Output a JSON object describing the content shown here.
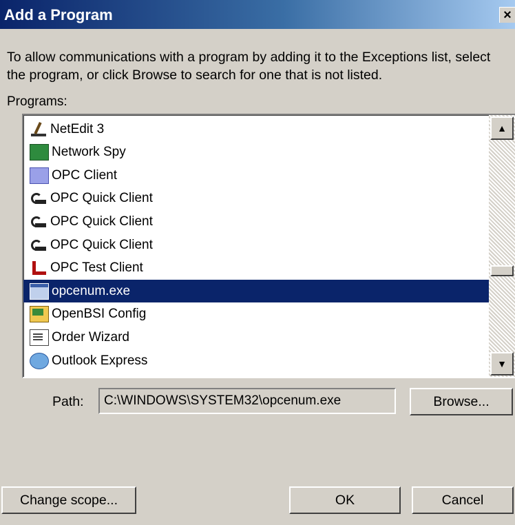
{
  "window": {
    "title": "Add a Program",
    "close_glyph": "×"
  },
  "description": "To allow communications with a program by adding it to the Exceptions list, select the program, or click Browse to search for one that is not listed.",
  "programs_label": "Programs:",
  "programs": [
    {
      "label": "NetEdit 3",
      "icon": "netedit-icon",
      "selected": false
    },
    {
      "label": "Network Spy",
      "icon": "network-spy-icon",
      "selected": false
    },
    {
      "label": "OPC Client",
      "icon": "opc-client-icon",
      "selected": false
    },
    {
      "label": "OPC Quick Client",
      "icon": "opc-quick-client-icon",
      "selected": false
    },
    {
      "label": "OPC Quick Client",
      "icon": "opc-quick-client-icon",
      "selected": false
    },
    {
      "label": "OPC Quick Client",
      "icon": "opc-quick-client-icon",
      "selected": false
    },
    {
      "label": "OPC Test Client",
      "icon": "opc-test-client-icon",
      "selected": false
    },
    {
      "label": "opcenum.exe",
      "icon": "application-window-icon",
      "selected": true
    },
    {
      "label": "OpenBSI Config",
      "icon": "openbsi-config-icon",
      "selected": false
    },
    {
      "label": "Order Wizard",
      "icon": "order-wizard-icon",
      "selected": false
    },
    {
      "label": "Outlook Express",
      "icon": "outlook-express-icon",
      "selected": false
    }
  ],
  "path": {
    "label": "Path:",
    "value": "C:\\WINDOWS\\SYSTEM32\\opcenum.exe"
  },
  "buttons": {
    "browse": "Browse...",
    "change_scope": "Change scope...",
    "ok": "OK",
    "cancel": "Cancel"
  },
  "scrollbar": {
    "up_glyph": "▲",
    "down_glyph": "▼"
  },
  "colors": {
    "selection": "#0a246a",
    "dialog_face": "#d4d0c8"
  }
}
